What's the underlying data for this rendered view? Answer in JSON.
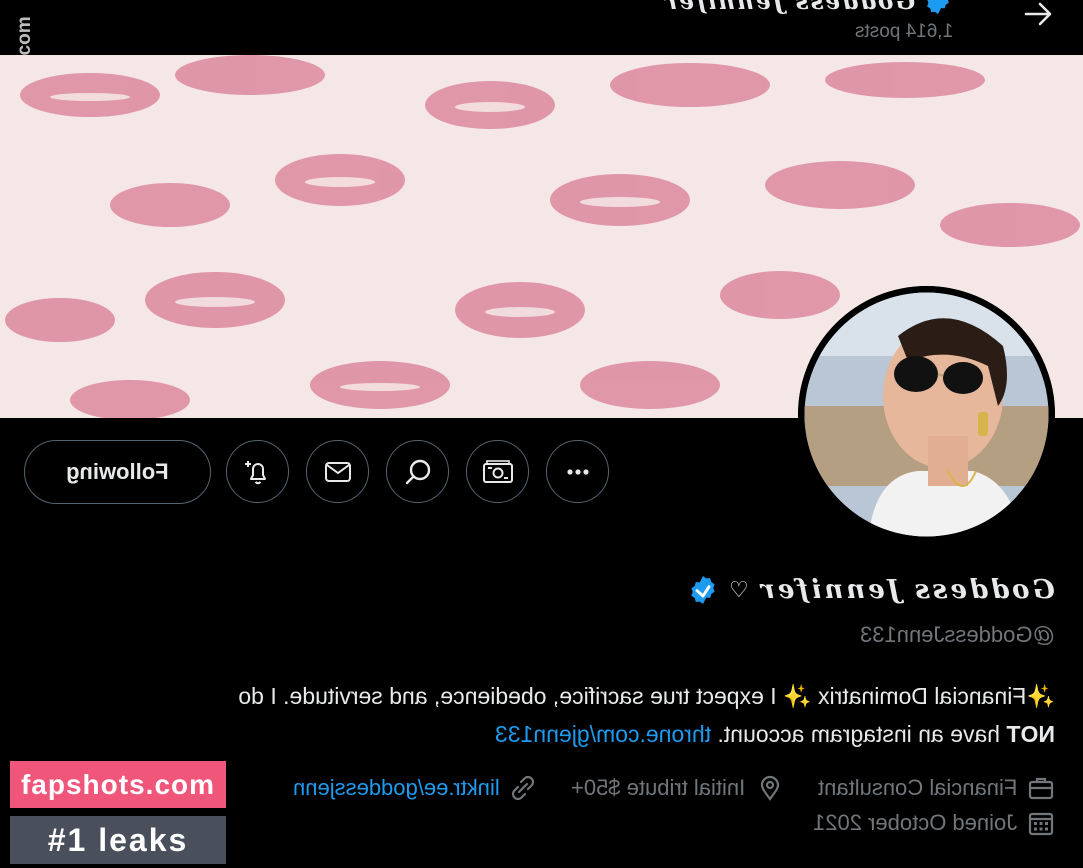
{
  "header": {
    "title": "Goddess Jennifer",
    "posts_count": "1,614 posts"
  },
  "watermark_side": "openingbook.com",
  "profile": {
    "display_name": "Goddess Jennifer",
    "handle": "@GoddessJenn133",
    "verified": true,
    "accent_color": "#1d9bf0"
  },
  "actions": {
    "following_label": "Following"
  },
  "bio": {
    "line1_prefix": "✨Financial Dominatrix ✨ I expect true sacrifice, obedience, and servitude. I do",
    "line2_strong": "NOT",
    "line2_text": "have an instagram account.",
    "line2_link": "throne.com/gjenn133"
  },
  "meta": {
    "profession": "Financial Consultant",
    "location": "Initial tribute $50+",
    "website": "linktr.ee/goddessjenn",
    "joined": "Joined October 2021"
  },
  "badge": {
    "site": "fapshots.com",
    "tagline": "#1 leaks",
    "site_color": "#f0557a",
    "tagline_color": "#4a4f5c"
  }
}
